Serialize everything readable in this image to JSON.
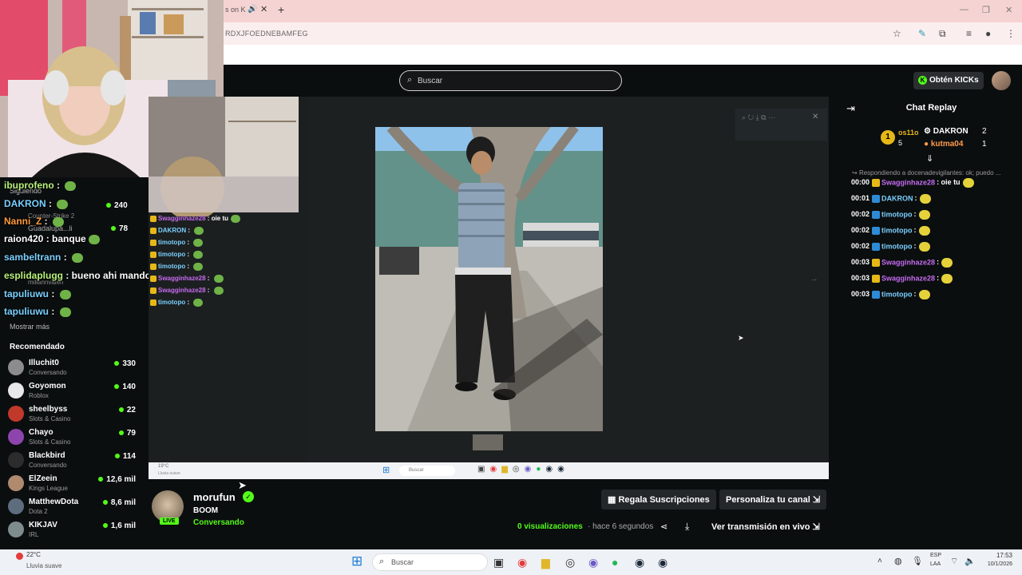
{
  "browser": {
    "tab_fragment": "s on K",
    "url_fragment": "RDXJFOEDNEBAMFEG"
  },
  "site": {
    "search_placeholder": "Buscar",
    "kicks_button": "Obtén KICKs"
  },
  "overlay_chat": [
    {
      "name": "ibuprofeno",
      "msg": " : "
    },
    {
      "name": "DAKRON",
      "msg": " : "
    },
    {
      "name": "Nanni_Z",
      "msg": " : "
    },
    {
      "name": "raion420",
      "msg": " : banque"
    },
    {
      "name": "sambeltrann",
      "msg": " : "
    },
    {
      "name": "esplidaplugg",
      "msg": " : bueno ahi mando"
    },
    {
      "name": "tapuliuwu",
      "msg": " : "
    },
    {
      "name": "tapuliuwu",
      "msg": " : "
    }
  ],
  "sidebar_ghost": {
    "following": "Siguiendo",
    "dakron_cat": "Counter-Strike 2",
    "dakron_count": "240",
    "guada": "Guadalupa...li",
    "guada_count": "78",
    "ghost_user": "miliannvalen"
  },
  "sidebar": {
    "show_more": "Mostrar más",
    "recommended_title": "Recomendado",
    "recommended": [
      {
        "name": "Illuchit0",
        "category": "Conversando",
        "count": "330",
        "color": "#8c8c8c"
      },
      {
        "name": "Goyomon",
        "category": "Roblox",
        "count": "140",
        "color": "#e8e8e8"
      },
      {
        "name": "sheelbyss",
        "category": "Slots & Casino",
        "count": "22",
        "color": "#c0392b"
      },
      {
        "name": "Chayo",
        "category": "Slots & Casino",
        "count": "79",
        "color": "#8e44ad"
      },
      {
        "name": "Blackbird",
        "category": "Conversando",
        "count": "114",
        "color": "#2c2c2c"
      },
      {
        "name": "ElZeein",
        "category": "Kings League",
        "count": "12,6 mil",
        "color": "#b08a6e"
      },
      {
        "name": "MatthewDota",
        "category": "Dota 2",
        "count": "8,6 mil",
        "color": "#5d6d7e"
      },
      {
        "name": "KIKJAV",
        "category": "IRL",
        "count": "1,6 mil",
        "color": "#7f8c8d"
      }
    ]
  },
  "video_chat": [
    {
      "name": "Swagginhaze28",
      "msg": " : oie tu"
    },
    {
      "name": "DAKRON",
      "msg": " : "
    },
    {
      "name": "timotopo",
      "msg": " : "
    },
    {
      "name": "timotopo",
      "msg": " : "
    },
    {
      "name": "timotopo",
      "msg": " : "
    },
    {
      "name": "Swagginhaze28",
      "msg": " : "
    },
    {
      "name": "Swagginhaze28",
      "msg": " : "
    },
    {
      "name": "timotopo",
      "msg": " : "
    }
  ],
  "chat_replay": {
    "title": "Chat Replay",
    "rank_pos": "1",
    "top_left_name": "os11o",
    "top_left_count": "5",
    "top_right_1": "DAKRON",
    "top_right_1_count": "2",
    "top_right_2": "kutma04",
    "top_right_2_count": "1",
    "reply_note": "Respondiendo a docenadevigilantes: ok; puedo ...",
    "lines": [
      {
        "time": "00:00",
        "name": "Swagginhaze28",
        "msg": ": oie tu",
        "color": "#c56cf0"
      },
      {
        "time": "00:01",
        "name": "DAKRON",
        "msg": ":",
        "color": "#7ad0ff"
      },
      {
        "time": "00:02",
        "name": "timotopo",
        "msg": ":",
        "color": "#7ad0ff"
      },
      {
        "time": "00:02",
        "name": "timotopo",
        "msg": ":",
        "color": "#7ad0ff"
      },
      {
        "time": "00:02",
        "name": "timotopo",
        "msg": ":",
        "color": "#7ad0ff"
      },
      {
        "time": "00:03",
        "name": "Swagginhaze28",
        "msg": ":",
        "color": "#c56cf0"
      },
      {
        "time": "00:03",
        "name": "Swagginhaze28",
        "msg": ":",
        "color": "#c56cf0"
      },
      {
        "time": "00:03",
        "name": "timotopo",
        "msg": ":",
        "color": "#7ad0ff"
      }
    ]
  },
  "stream": {
    "username": "morufun",
    "title": "BOOM",
    "category": "Conversando",
    "live_badge": "LIVE",
    "gift_subs": "Regala Suscripciones",
    "customize": "Personaliza tu canal",
    "views": "0 visualizaciones",
    "ago": "· hace 6 segundos",
    "watch_live": "Ver transmisión en vivo"
  },
  "video_taskbar": {
    "weather": "19°C",
    "weather_sub": "Lluvia suave",
    "search": "Buscar"
  },
  "taskbar": {
    "temp": "22°C",
    "weather": "Lluvia suave",
    "search": "Buscar",
    "lang": "ESP",
    "lang2": "LAA",
    "time": "17:53",
    "date": "10/1/2026"
  }
}
